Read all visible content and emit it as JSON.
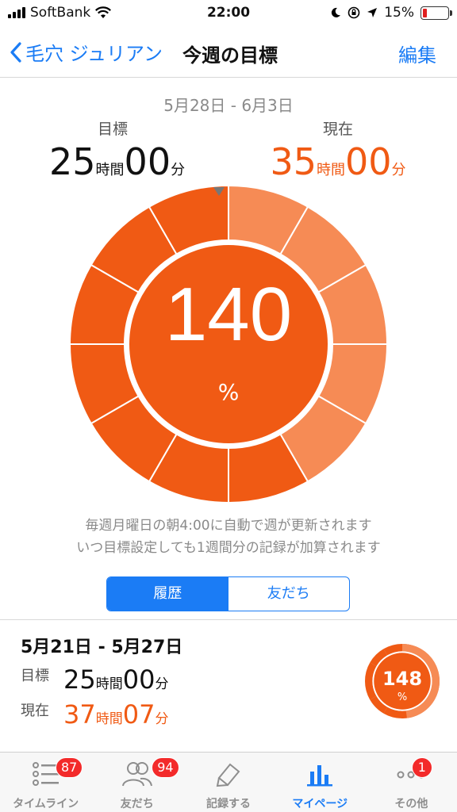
{
  "status_bar": {
    "carrier": "SoftBank",
    "time": "22:00",
    "battery": "15%",
    "battery_level": 0.15
  },
  "nav": {
    "back_label": "毛穴 ジュリアン",
    "title": "今週の目標",
    "edit_label": "編集"
  },
  "current_week": {
    "period": "5月28日 - 6月3日",
    "goal_label": "目標",
    "goal_hours": "25",
    "goal_minutes": "00",
    "current_label": "現在",
    "current_hours": "35",
    "current_minutes": "00",
    "hours_unit": "時間",
    "minutes_unit": "分",
    "percent": "140",
    "percent_unit": "%",
    "progress_ratio": 1.4
  },
  "notes": {
    "line1": "毎週月曜日の朝4:00に自動で週が更新されます",
    "line2": "いつ目標設定しても1週間分の記録が加算されます"
  },
  "segmented": {
    "history_label": "履歴",
    "friends_label": "友だち"
  },
  "history": {
    "period": "5月21日 - 5月27日",
    "goal_label": "目標",
    "goal_hours": "25",
    "goal_minutes": "00",
    "current_label": "現在",
    "current_hours": "37",
    "current_minutes": "07",
    "hours_unit": "時間",
    "minutes_unit": "分",
    "percent": "148",
    "percent_unit": "%",
    "progress_ratio": 1.48
  },
  "tabs": [
    {
      "label": "タイムライン",
      "badge": "87",
      "icon": "timeline-icon"
    },
    {
      "label": "友だち",
      "badge": "94",
      "icon": "friends-icon"
    },
    {
      "label": "記録する",
      "badge": "",
      "icon": "record-icon"
    },
    {
      "label": "マイページ",
      "badge": "",
      "icon": "mypage-chart-icon"
    },
    {
      "label": "その他",
      "badge": "1",
      "icon": "more-icon"
    }
  ],
  "colors": {
    "primary_orange": "#f05a14",
    "light_orange": "#f68b55",
    "accent_blue": "#1b7cf5",
    "badge_red": "#f32a2a"
  }
}
